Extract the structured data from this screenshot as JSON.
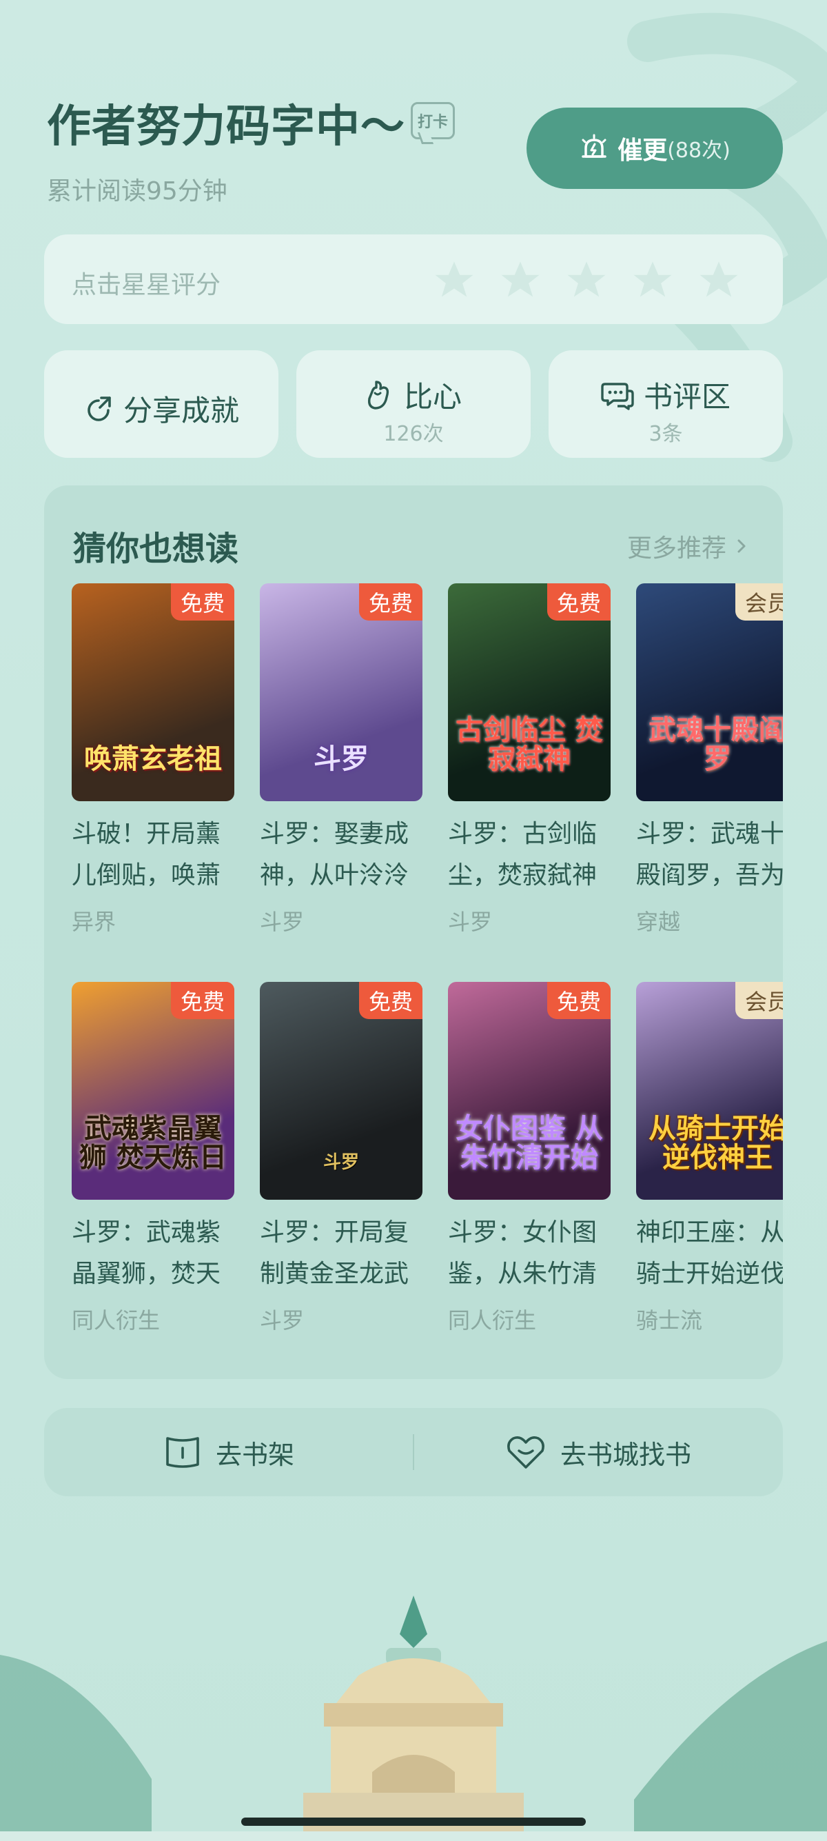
{
  "header": {
    "title": "作者努力码字中～",
    "checkin_badge": "打卡",
    "reading_time": "累计阅读95分钟",
    "urge_button": {
      "label": "催更",
      "count": "(88次)"
    }
  },
  "rating": {
    "label": "点击星星评分",
    "stars_total": 5,
    "stars_selected": 0
  },
  "actions": {
    "share": {
      "label": "分享成就"
    },
    "heart": {
      "label": "比心",
      "sub": "126次"
    },
    "comments": {
      "label": "书评区",
      "sub": "3条"
    }
  },
  "recommend": {
    "title": "猜你也想读",
    "more": "更多推荐",
    "books": [
      {
        "badge": "免费",
        "badge_type": "free",
        "cover_text": "唤萧玄老祖",
        "title": "斗破！开局薰儿倒贴，唤萧",
        "category": "异界",
        "cover_colors": [
          "#3a2a1e",
          "#b8621f"
        ]
      },
      {
        "badge": "免费",
        "badge_type": "free",
        "cover_text": "斗罗",
        "title": "斗罗：娶妻成神，从叶泠泠",
        "category": "斗罗",
        "cover_colors": [
          "#5e4a8f",
          "#c9b6e6"
        ]
      },
      {
        "badge": "免费",
        "badge_type": "free",
        "cover_text": "古剑临尘 焚寂弑神",
        "title": "斗罗：古剑临尘，焚寂弑神",
        "category": "斗罗",
        "cover_colors": [
          "#0d1f17",
          "#3c6b3a"
        ]
      },
      {
        "badge": "会员",
        "badge_type": "vip",
        "cover_text": "武魂十殿阎罗",
        "title": "斗罗：武魂十殿阎罗，吾为",
        "category": "穿越",
        "cover_colors": [
          "#0f1830",
          "#2e4a7a"
        ]
      },
      {
        "badge": "免费",
        "badge_type": "free",
        "cover_text": "武魂紫晶翼狮 焚天炼日",
        "title": "斗罗：武魂紫晶翼狮，焚天",
        "category": "同人衍生",
        "cover_colors": [
          "#5a2c7a",
          "#f0a030"
        ]
      },
      {
        "badge": "免费",
        "badge_type": "free",
        "cover_text": "斗罗",
        "title": "斗罗：开局复制黄金圣龙武",
        "category": "斗罗",
        "cover_colors": [
          "#1a1d1f",
          "#4e5a5e"
        ]
      },
      {
        "badge": "免费",
        "badge_type": "free",
        "cover_text": "女仆图鉴 从朱竹清开始",
        "title": "斗罗：女仆图鉴，从朱竹清",
        "category": "同人衍生",
        "cover_colors": [
          "#3a1a3a",
          "#c06a9a"
        ]
      },
      {
        "badge": "会员",
        "badge_type": "vip",
        "cover_text": "从骑士开始 逆伐神王",
        "title": "神印王座：从骑士开始逆伐",
        "category": "骑士流",
        "cover_colors": [
          "#2a2348",
          "#b8a0d8"
        ]
      }
    ]
  },
  "bottom": {
    "bookshelf": "去书架",
    "bookstore": "去书城找书"
  }
}
